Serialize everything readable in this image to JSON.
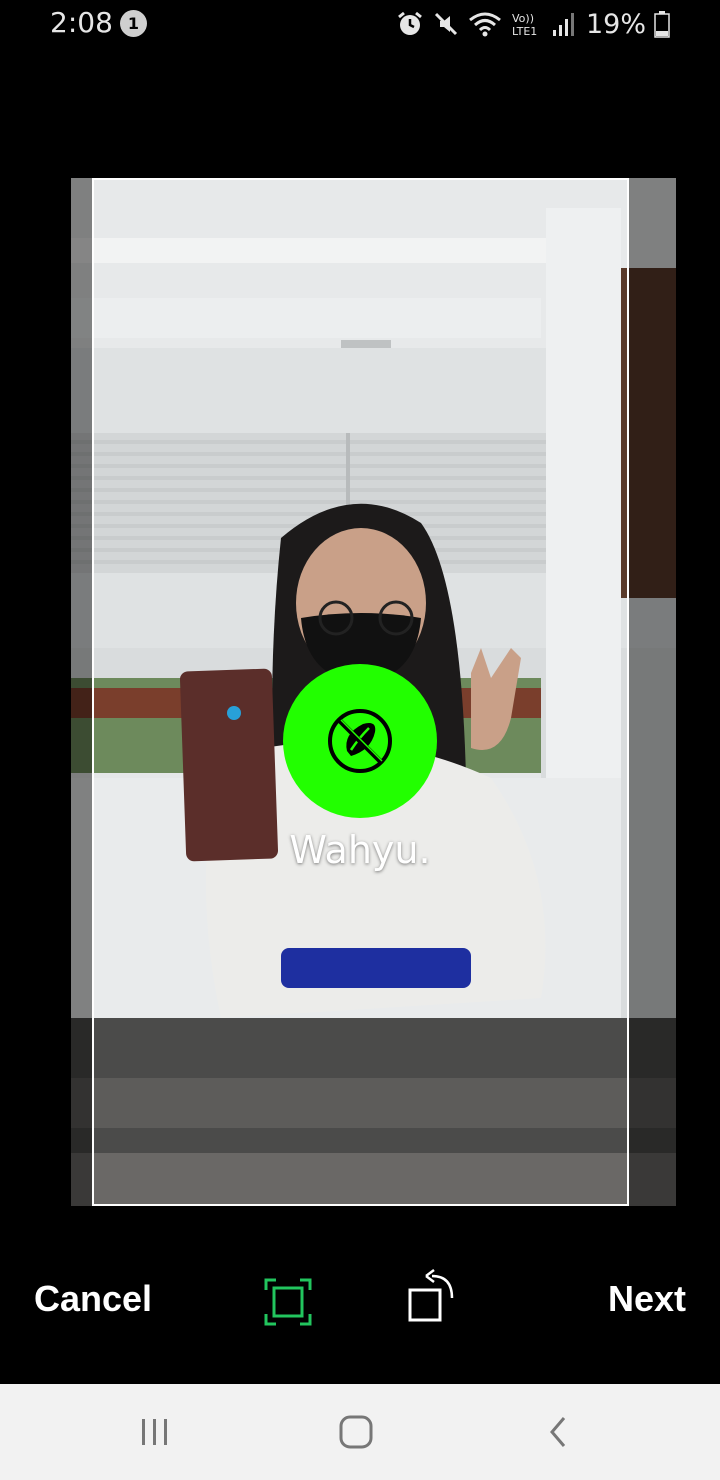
{
  "status_bar": {
    "time": "2:08",
    "notification_count": "1",
    "battery_percent": "19%",
    "icons": [
      "alarm-icon",
      "mute-icon",
      "wifi-icon",
      "volte-lte1-icon",
      "signal-icon",
      "battery-icon"
    ]
  },
  "image_editor": {
    "photo_description_icon": "photo-selfie-image",
    "sticker": {
      "icon": "no-nuts-icon",
      "color": "#22ff00",
      "label": "Wahyu."
    }
  },
  "toolbar": {
    "cancel_label": "Cancel",
    "next_label": "Next",
    "crop_icon": "crop-frame-icon",
    "rotate_icon": "rotate-icon",
    "accent_color": "#22c55e"
  },
  "nav_bar": {
    "icons": [
      "recent-apps-icon",
      "home-icon",
      "back-icon"
    ]
  }
}
